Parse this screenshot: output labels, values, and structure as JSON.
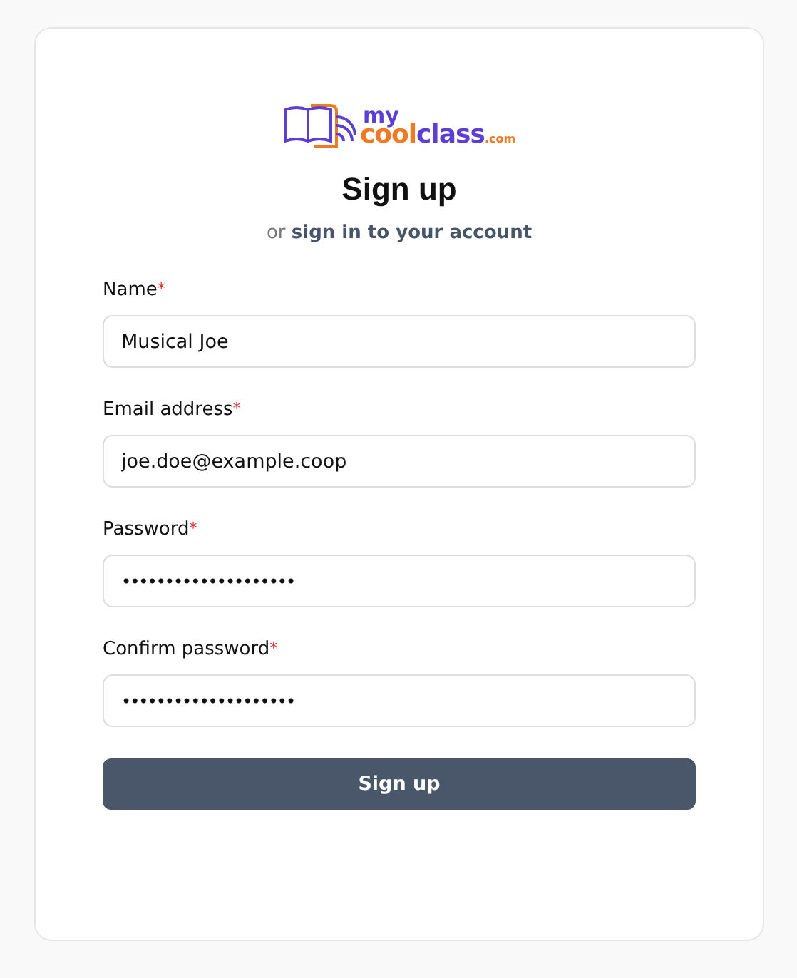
{
  "logo": {
    "parts": [
      {
        "text": "my",
        "color": "#5b3fd0"
      },
      {
        "text": "cool",
        "color": "#f07a24"
      },
      {
        "text": "class",
        "color": "#5b3fd0"
      },
      {
        "text": ".com",
        "color": "#f07a24"
      }
    ]
  },
  "title": "Sign up",
  "subtitle": {
    "prefix": "or",
    "link": "sign in to your account"
  },
  "fields": [
    {
      "label": "Name",
      "required_mark": "*",
      "value": "Musical Joe"
    },
    {
      "label": "Email address",
      "required_mark": "*",
      "value": "joe.doe@example.coop"
    },
    {
      "label": "Password",
      "required_mark": "*",
      "value": "••••••••••••••••••••"
    },
    {
      "label": "Confirm password",
      "required_mark": "*",
      "value": "••••••••••••••••••••"
    }
  ],
  "submit": "Sign up"
}
